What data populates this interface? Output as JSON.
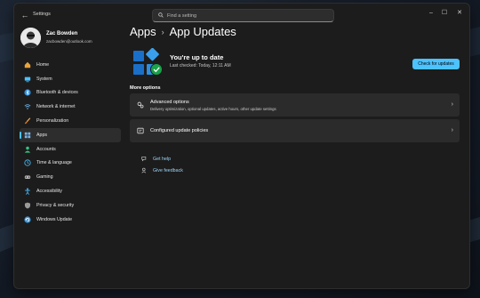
{
  "window": {
    "app_title": "Settings"
  },
  "search": {
    "placeholder": "Find a setting"
  },
  "window_controls": {
    "minimize": "–",
    "maximize": "☐",
    "close": "✕"
  },
  "profile": {
    "name": "Zac Bowden",
    "email": "zacbowden@outlook.com"
  },
  "nav": {
    "items": [
      {
        "label": "Home",
        "icon": "home-icon",
        "color": "#e8a33c"
      },
      {
        "label": "System",
        "icon": "system-icon",
        "color": "#4cc2ff"
      },
      {
        "label": "Bluetooth & devices",
        "icon": "bluetooth-icon",
        "color": "#2f8fdf"
      },
      {
        "label": "Network & internet",
        "icon": "network-icon",
        "color": "#6cb8f0"
      },
      {
        "label": "Personalization",
        "icon": "brush-icon",
        "color": "#f0a24a"
      },
      {
        "label": "Apps",
        "icon": "apps-icon",
        "color": "#7ab3e8",
        "active": true
      },
      {
        "label": "Accounts",
        "icon": "accounts-icon",
        "color": "#33c481"
      },
      {
        "label": "Time & language",
        "icon": "globe-clock-icon",
        "color": "#4cc2ff"
      },
      {
        "label": "Gaming",
        "icon": "gaming-icon",
        "color": "#b7b7b7"
      },
      {
        "label": "Accessibility",
        "icon": "accessibility-icon",
        "color": "#4cc2ff"
      },
      {
        "label": "Privacy & security",
        "icon": "shield-icon",
        "color": "#9a9a9a"
      },
      {
        "label": "Windows Update",
        "icon": "windows-update-icon",
        "color": "#3a9be0"
      }
    ]
  },
  "breadcrumb": {
    "parent": "Apps",
    "separator": "›",
    "current": "App Updates"
  },
  "status": {
    "title": "You're up to date",
    "last_checked": "Last checked: Today, 12:11 AM",
    "button": "Check for updates"
  },
  "more_options": {
    "heading": "More options"
  },
  "cards": [
    {
      "title": "Advanced options",
      "subtitle": "Delivery optimization, optional updates, active hours, other update settings",
      "icon": "gears-icon"
    },
    {
      "title": "Configured update policies",
      "icon": "policy-icon"
    }
  ],
  "help": {
    "get_help": "Get help",
    "give_feedback": "Give feedback"
  },
  "accent_color": "#4cc2ff"
}
